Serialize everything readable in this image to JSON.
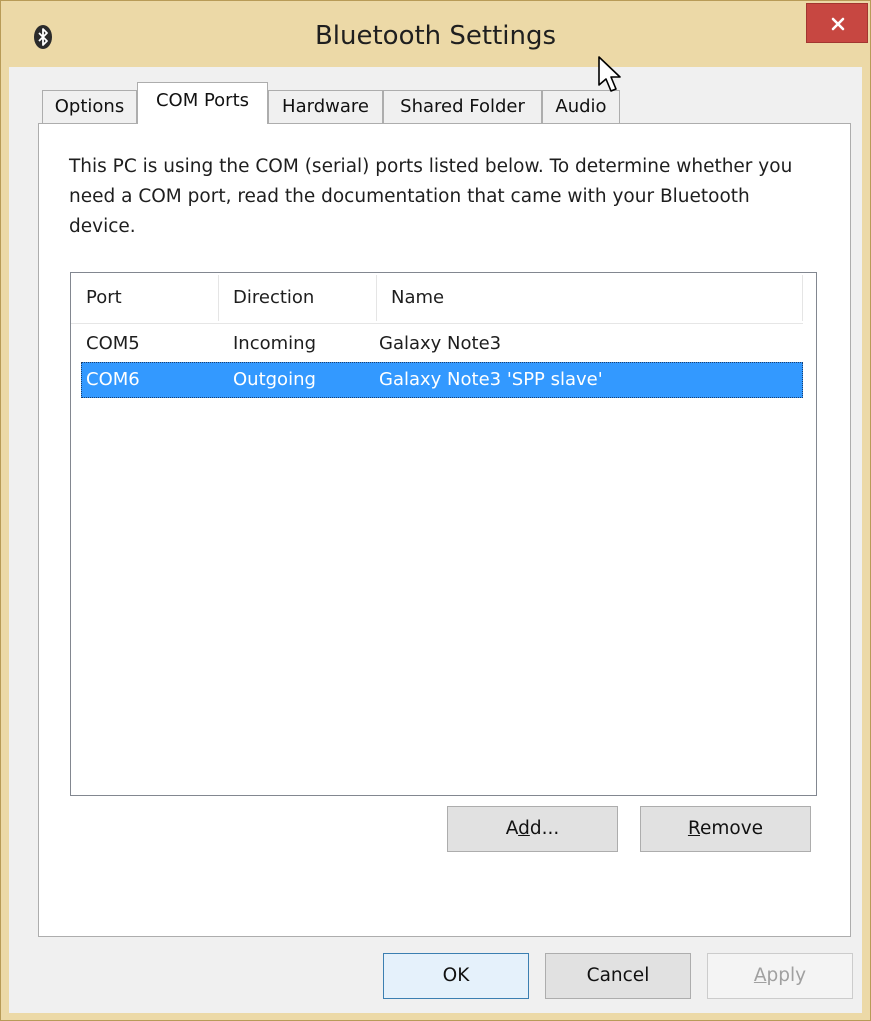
{
  "window": {
    "title": "Bluetooth Settings",
    "close_label": "×"
  },
  "tabs": [
    {
      "label": "Options"
    },
    {
      "label": "COM Ports"
    },
    {
      "label": "Hardware"
    },
    {
      "label": "Shared Folder"
    },
    {
      "label": "Audio"
    }
  ],
  "active_tab": "COM Ports",
  "description": "This PC is using the COM (serial) ports listed below. To determine whether you need a COM port, read the documentation that came with your Bluetooth device.",
  "ports_list": {
    "columns": [
      "Port",
      "Direction",
      "Name"
    ],
    "rows": [
      {
        "port": "COM5",
        "direction": "Incoming",
        "name": "Galaxy Note3"
      },
      {
        "port": "COM6",
        "direction": "Outgoing",
        "name": "Galaxy Note3 'SPP slave'"
      }
    ],
    "selected_row": 1
  },
  "list_buttons": {
    "add_prefix": "A",
    "add_mnemonic": "d",
    "add_suffix": "d...",
    "remove_mnemonic": "R",
    "remove_suffix": "emove"
  },
  "dialog_buttons": {
    "ok": "OK",
    "cancel": "Cancel",
    "apply_mnemonic": "A",
    "apply_suffix": "pply"
  },
  "colors": {
    "titlebar": "#ecd9a7",
    "close": "#c74741",
    "selection": "#3399ff"
  }
}
